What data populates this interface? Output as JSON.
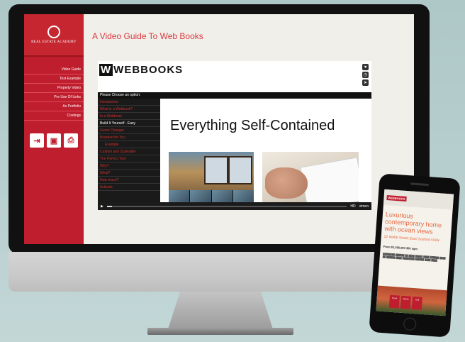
{
  "website": {
    "brand": "REAL ESTATE ACADEMY",
    "title": "A Video Guide To Web Books",
    "nav": [
      "Video Guide",
      "Text Example",
      "Property Video",
      "Pre Use Of Links",
      "As Portfolio",
      "Costings"
    ]
  },
  "player": {
    "logo": "WEBBOOKS",
    "choose_prompt": "Please Choose an option:",
    "menu": [
      "Introduction",
      "What is a Webbook?",
      "In a Webbook",
      "Build It Yourself - Easy",
      "Game Changer",
      "Branded for You",
      "Example",
      "Custom and Scaleable",
      "The Perfect Tool",
      "Why?",
      "What?",
      "How much?",
      "Activate"
    ],
    "active_index": 3,
    "headline": "Everything Self-Contained",
    "vimeo": "vimeo",
    "hd": "HD"
  },
  "phone": {
    "logo": "WEBBOOKS",
    "title": "Luxurious contemporary home with ocean views",
    "address": "22 Webb Street East Gosford NSW",
    "price": "From $1,295,000 350 sqm",
    "buttons": [
      "Book",
      "Quote",
      "Call"
    ]
  }
}
